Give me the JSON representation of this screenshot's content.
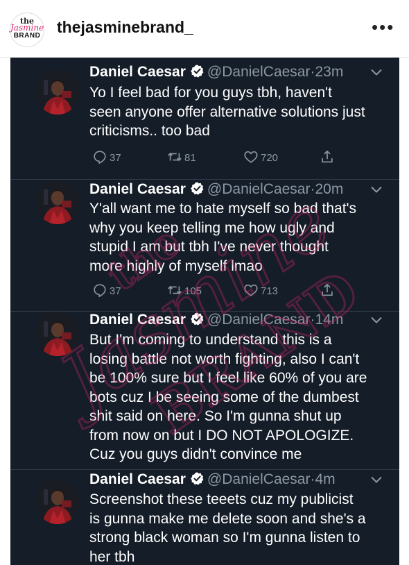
{
  "post": {
    "username": "thejasminebrand_",
    "more_glyph": "•••",
    "logo": {
      "the": "the",
      "jasmine": "Jasmine",
      "brand": "BRAND"
    }
  },
  "colors": {
    "tweet_bg": "#141d28",
    "secondary_text": "#8b98a5",
    "verified_bg": "#ffffff",
    "watermark": "#d6276e"
  },
  "watermark_text": "theJasmineBRAND",
  "tweets": [
    {
      "author": "Daniel Caesar",
      "handle": "@DanielCaesar",
      "separator": "·",
      "time": "23m",
      "text": "Yo I feel bad for you guys tbh, haven't\nseen anyone offer alternative solutions just\ncriticisms.. too bad",
      "replies": "37",
      "retweets": "81",
      "likes": "720"
    },
    {
      "author": "Daniel Caesar",
      "handle": "@DanielCaesar",
      "separator": "·",
      "time": "20m",
      "text": "Y'all want me to hate myself so bad that's\nwhy you keep telling me how ugly and\nstupid I am but tbh I've never thought\nmore highly of myself lmao",
      "replies": "37",
      "retweets": "105",
      "likes": "713"
    },
    {
      "author": "Daniel Caesar",
      "handle": "@DanielCaesar",
      "separator": "·",
      "time": "14m",
      "text": "But I'm coming to understand this is a\nlosing battle not worth fighting, also I can't\nbe 100% sure but I feel like 60% of you are\nbots cuz I be seeing some of the dumbest\nshit said on here. So I'm gunna shut up\nfrom now on but I DO NOT APOLOGIZE.\nCuz you guys didn't convince me"
    },
    {
      "author": "Daniel Caesar",
      "handle": "@DanielCaesar",
      "separator": "·",
      "time": "4m",
      "text": "Screenshot these  teeets cuz my publicist\nis gunna make me delete soon and she's a\nstrong black woman so I'm gunna listen to\nher tbh"
    }
  ]
}
